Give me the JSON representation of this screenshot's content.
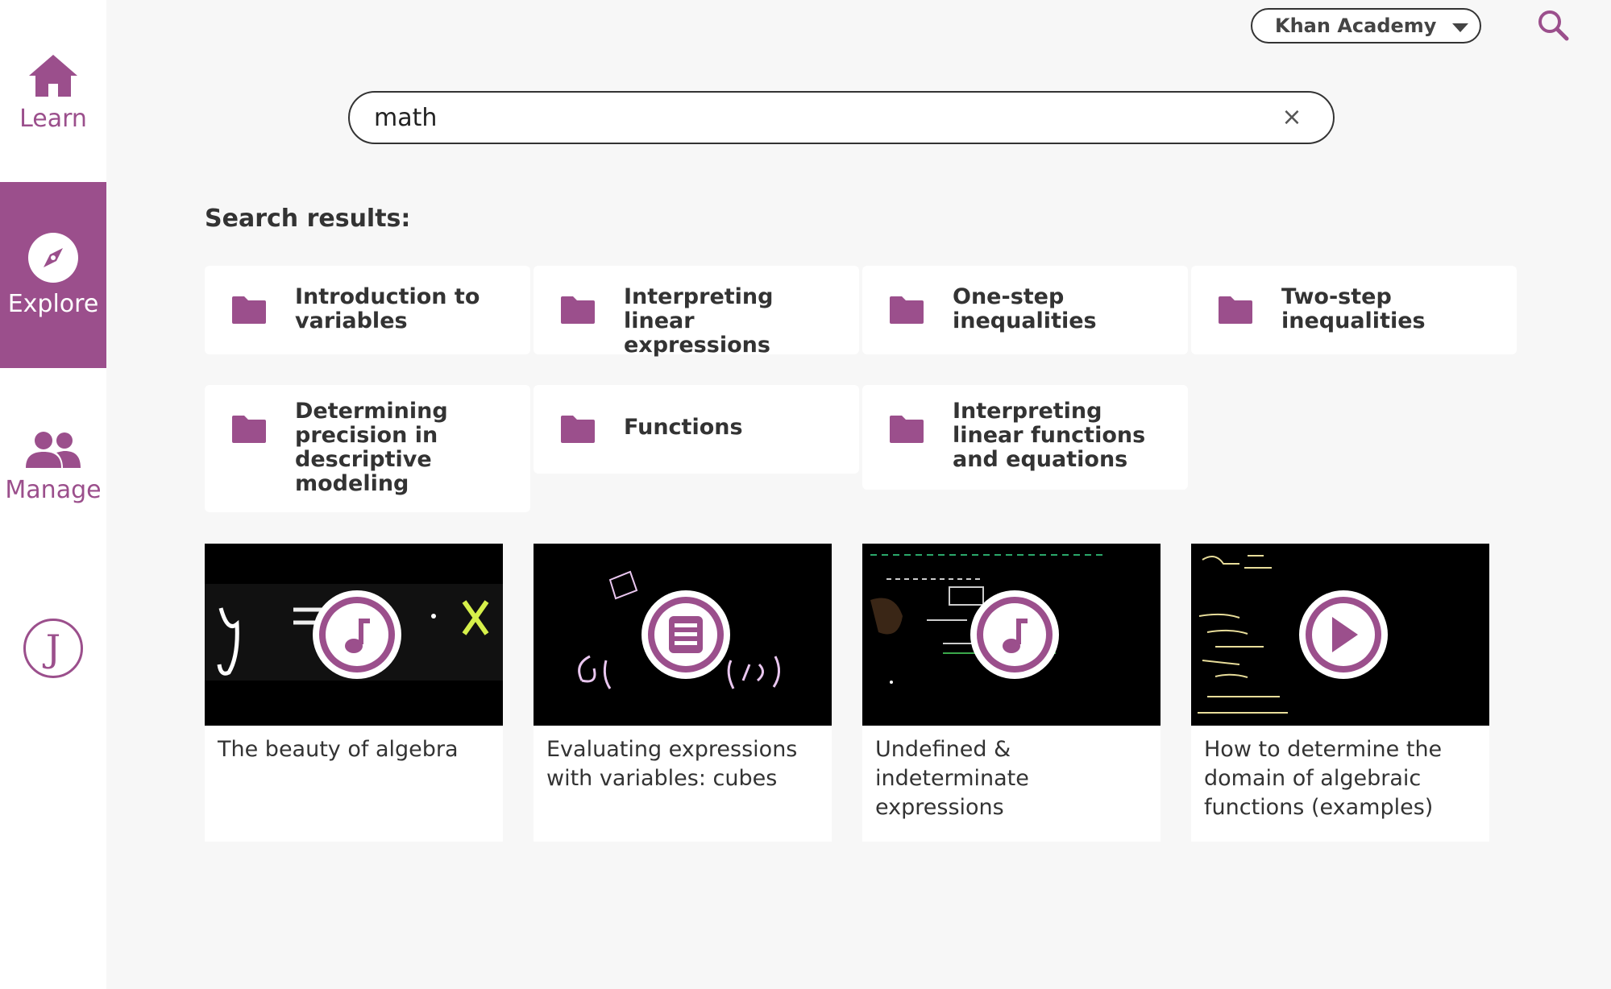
{
  "sidebar": {
    "learn": "Learn",
    "explore": "Explore",
    "manage": "Manage",
    "avatar_initial": "J"
  },
  "header": {
    "channel": "Khan Academy"
  },
  "search": {
    "value": "math"
  },
  "results_heading": "Search results:",
  "topics": [
    {
      "label": "Introduction to variables",
      "icon": "folder-icon"
    },
    {
      "label": "Interpreting linear expressions",
      "icon": "folder-icon"
    },
    {
      "label": "One-step inequalities",
      "icon": "folder-icon"
    },
    {
      "label": "Two-step inequalities",
      "icon": "folder-icon"
    },
    {
      "label": "Determining precision in descriptive modeling",
      "icon": "folder-icon"
    },
    {
      "label": "Functions",
      "icon": "folder-icon"
    },
    {
      "label": "Interpreting linear functions and equations",
      "icon": "folder-icon"
    }
  ],
  "content": [
    {
      "title": "The beauty of algebra",
      "kind": "audio",
      "icon": "music-note-icon"
    },
    {
      "title": "Evaluating expressions with variables: cubes",
      "kind": "document",
      "icon": "document-icon"
    },
    {
      "title": "Undefined & indeterminate expressions",
      "kind": "audio",
      "icon": "music-note-icon"
    },
    {
      "title": "How to determine the domain of algebraic functions (examples)",
      "kind": "video",
      "icon": "play-icon"
    }
  ],
  "colors": {
    "accent": "#9b4f8c",
    "background": "#f7f7f7"
  }
}
